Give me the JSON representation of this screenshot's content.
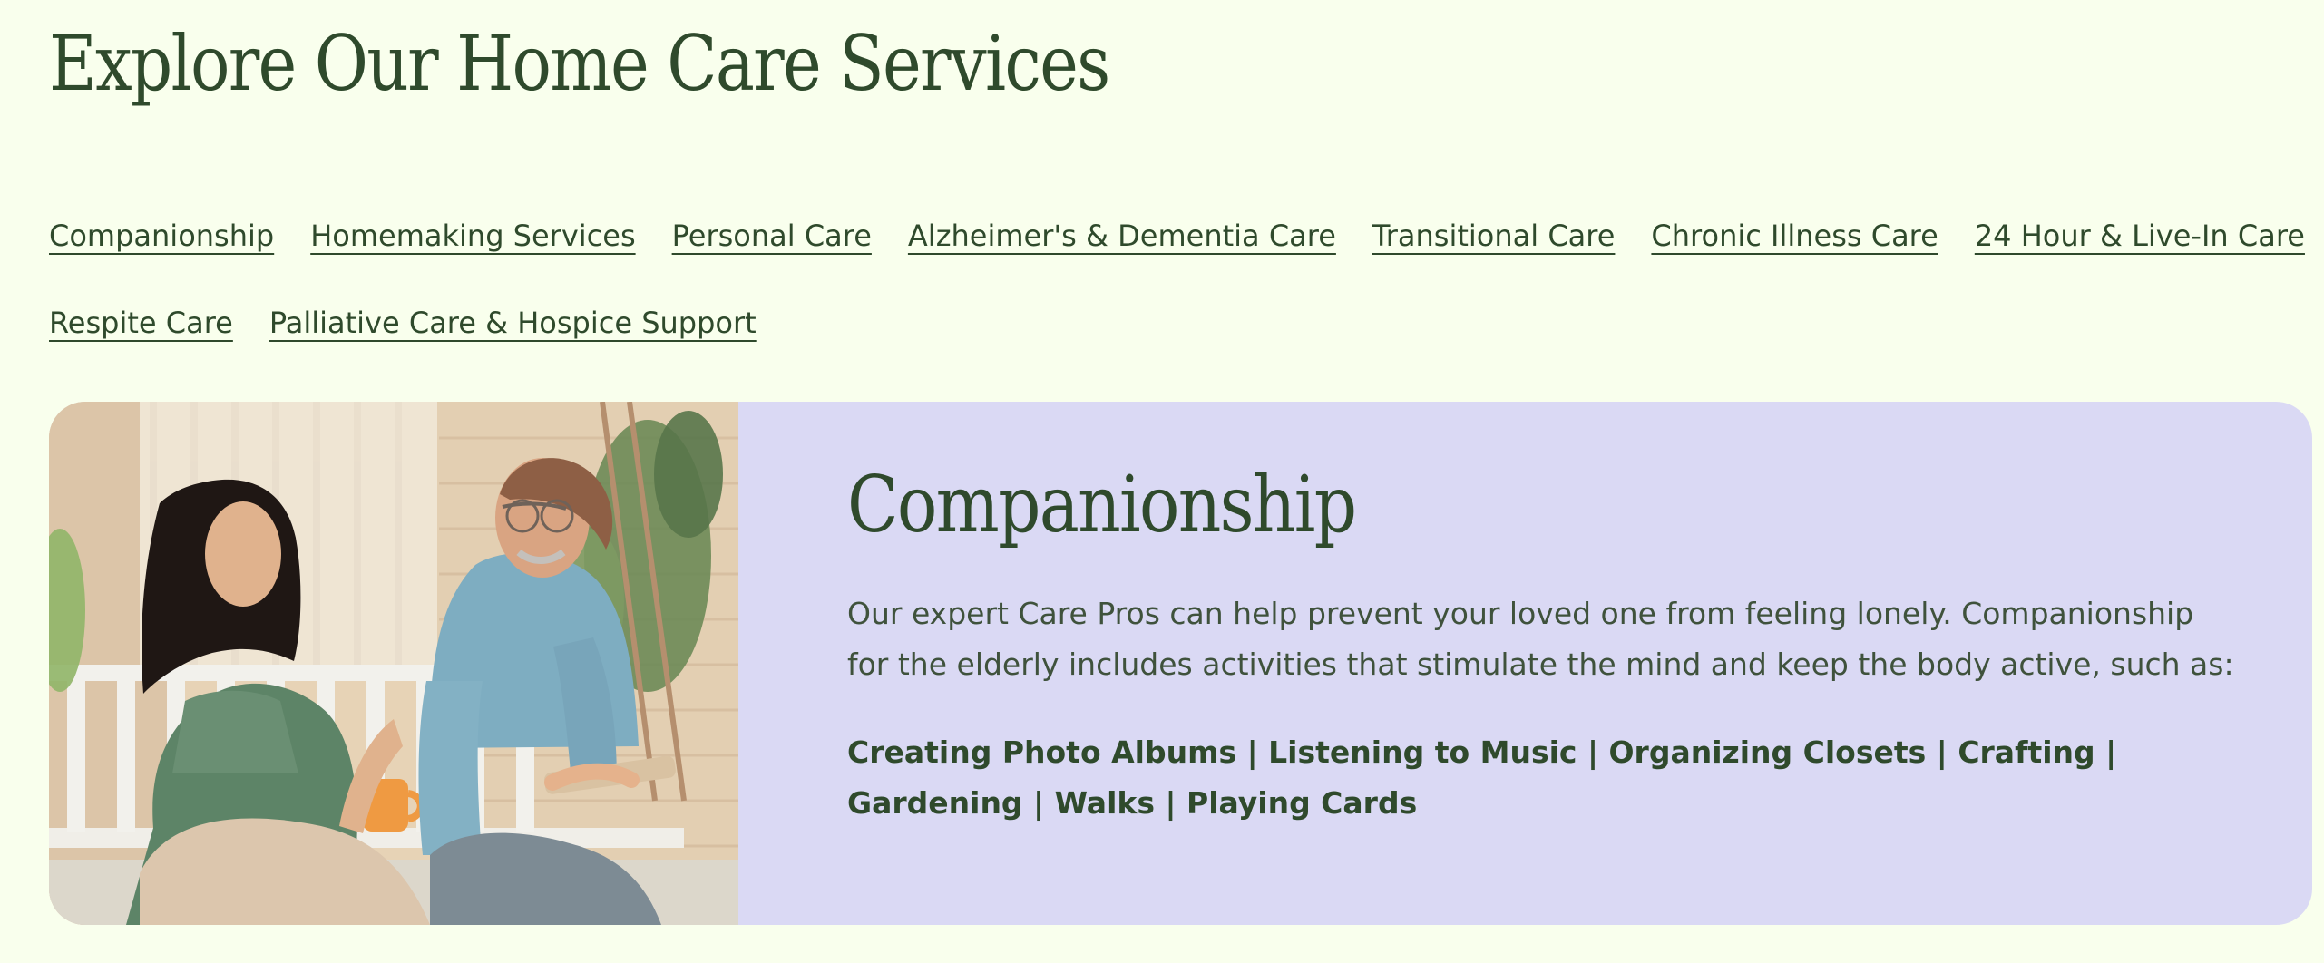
{
  "page": {
    "title": "Explore Our Home Care Services"
  },
  "service_links": [
    "Companionship",
    "Homemaking Services",
    "Personal Care",
    "Alzheimer's & Dementia Care",
    "Transitional Care",
    "Chronic Illness Care",
    "24 Hour & Live-In Care",
    "Respite Care",
    "Palliative Care & Hospice Support"
  ],
  "feature": {
    "title": "Companionship",
    "description": "Our expert Care Pros can help prevent your loved one from feeling lonely. Companionship for the elderly includes activities that stimulate the mind and keep the body active, such as:",
    "activities": "Creating Photo Albums | Listening to Music | Organizing Closets | Crafting | Gardening | Walks | Playing Cards"
  },
  "colors": {
    "background": "#f9ffed",
    "text": "#2f4a2c",
    "card": "#dad9f4"
  }
}
